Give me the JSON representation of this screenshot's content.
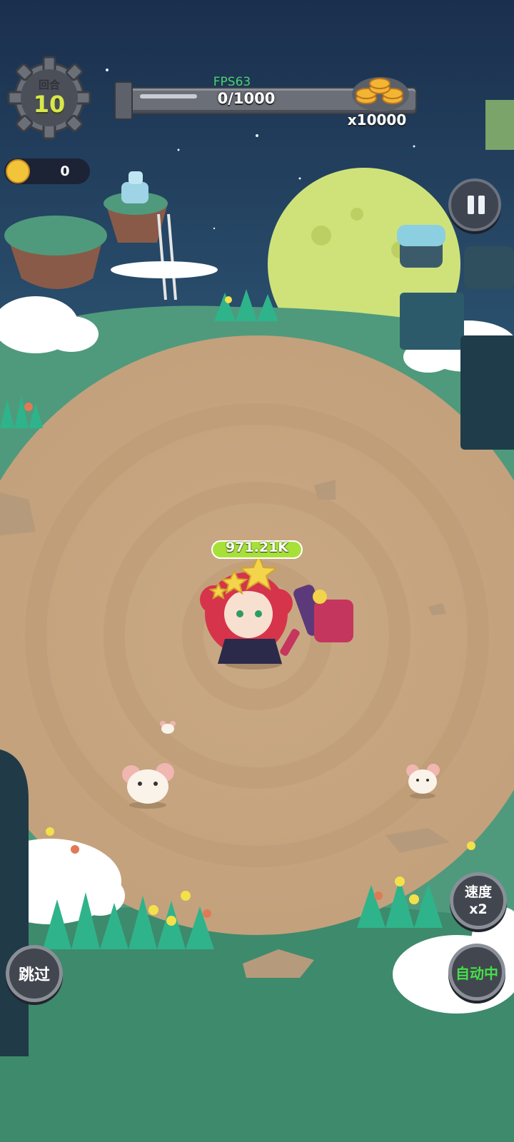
{
  "hud": {
    "round_label": "回合",
    "round_value": "10",
    "fps": "FPS63",
    "progress_text": "0/1000",
    "progress_fraction": 0,
    "reward_multiplier": "x10000",
    "gold_value": "0"
  },
  "character": {
    "hp_text": "971.21K",
    "stars": 3
  },
  "buttons": {
    "skip": "跳过",
    "speed_line1": "速度",
    "speed_line2": "x2",
    "auto": "自动中"
  },
  "colors": {
    "accent_green": "#45e04a",
    "round_yellow": "#d8e84a",
    "hp_green": "#a8e03a",
    "fps_green": "#4ad26e"
  },
  "icons": [
    "gear-icon",
    "coin-stack-icon",
    "gold-coin-icon",
    "pause-icon",
    "star-icon",
    "moon"
  ]
}
